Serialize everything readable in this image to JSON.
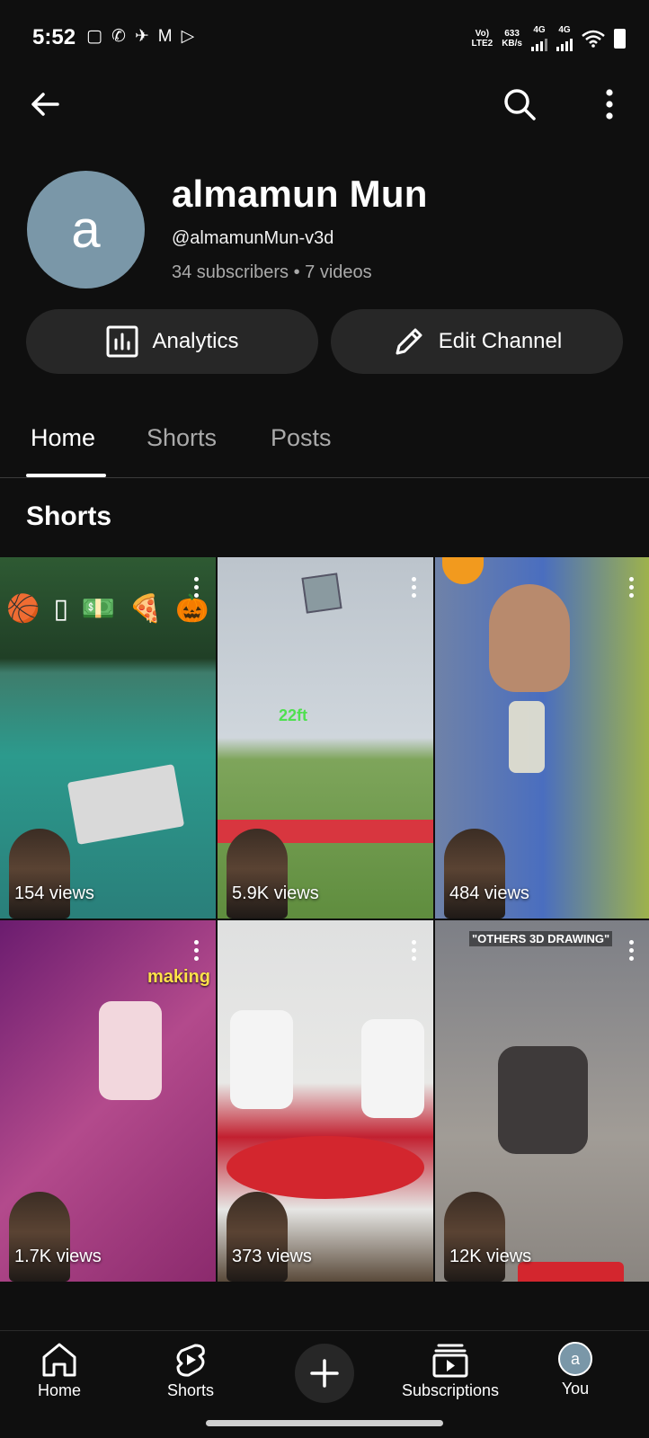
{
  "status_bar": {
    "time": "5:52",
    "network_label_top": "Vo)",
    "network_label_bottom": "LTE2",
    "speed_value": "633",
    "speed_unit": "KB/s",
    "sim1_label": "4G",
    "sim2_label": "4G"
  },
  "top_bar": {
    "back_icon": "back-arrow-icon",
    "search_icon": "search-icon",
    "more_icon": "more-vert-icon"
  },
  "channel": {
    "avatar_letter": "a",
    "avatar_color": "#7a97a8",
    "name": "almamun Mun",
    "handle": "@almamunMun-v3d",
    "meta": "34 subscribers • 7 videos"
  },
  "actions": {
    "analytics_label": "Analytics",
    "edit_label": "Edit Channel"
  },
  "tabs": [
    {
      "label": "Home",
      "active": true
    },
    {
      "label": "Shorts",
      "active": false
    },
    {
      "label": "Posts",
      "active": false
    }
  ],
  "section": {
    "title": "Shorts"
  },
  "shorts": [
    {
      "views": "154 views"
    },
    {
      "views": "5.9K views",
      "overlay_text": "22ft"
    },
    {
      "views": "484 views"
    },
    {
      "views": "1.7K views",
      "overlay_text": "making"
    },
    {
      "views": "373 views"
    },
    {
      "views": "12K views",
      "overlay_text": "\"OTHERS 3D DRAWING\""
    }
  ],
  "bottom_nav": {
    "home": "Home",
    "shorts": "Shorts",
    "subscriptions": "Subscriptions",
    "you": "You",
    "you_avatar_letter": "a"
  },
  "colors": {
    "background": "#0f0f0f",
    "pill": "#272727",
    "secondary_text": "#aaaaaa"
  }
}
